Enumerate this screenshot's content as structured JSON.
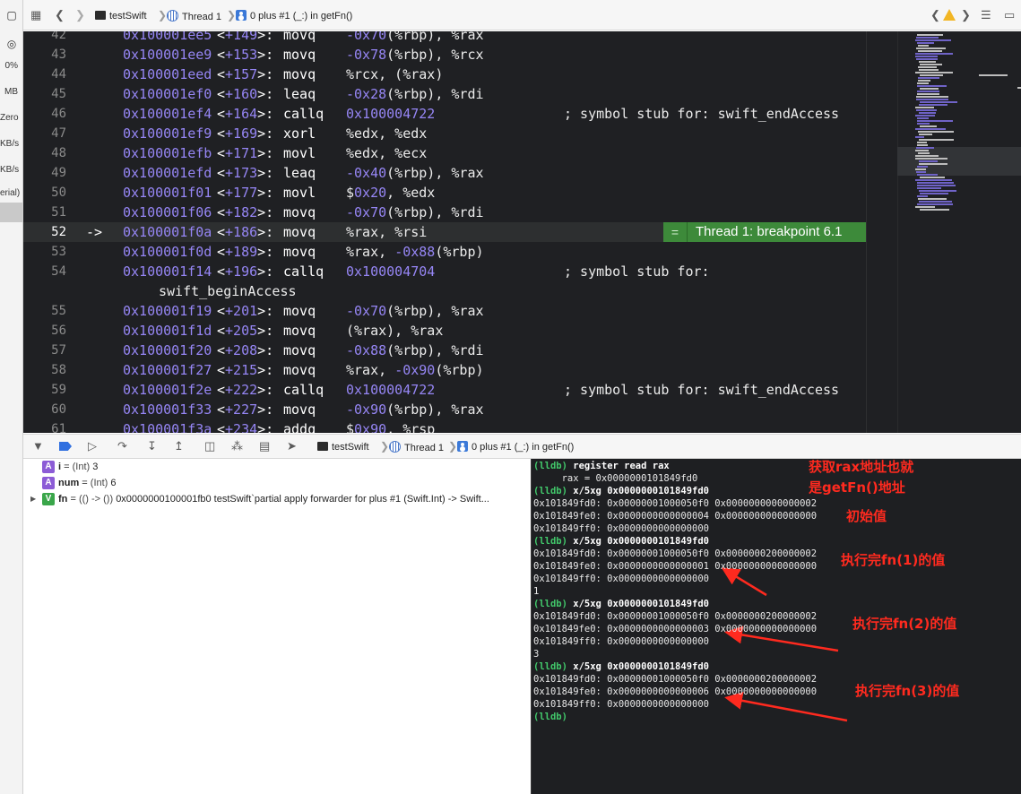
{
  "left_strip": {
    "items": [
      "0%",
      "MB",
      "Zero",
      "KB/s",
      "KB/s",
      "erial)"
    ]
  },
  "jumpbar": {
    "project": "testSwift",
    "thread": "Thread 1",
    "frame": "0 plus #1 (_:) in getFn()"
  },
  "editor": {
    "lines": [
      {
        "ln": "42",
        "addr": "0x100001ee5",
        "off": "+149",
        "mn": "movq",
        "ops": [
          [
            "n",
            "-0x70"
          ],
          [
            "t",
            "(%rbp), %rax"
          ]
        ],
        "cm": ""
      },
      {
        "ln": "43",
        "addr": "0x100001ee9",
        "off": "+153",
        "mn": "movq",
        "ops": [
          [
            "n",
            "-0x78"
          ],
          [
            "t",
            "(%rbp), %rcx"
          ]
        ],
        "cm": ""
      },
      {
        "ln": "44",
        "addr": "0x100001eed",
        "off": "+157",
        "mn": "movq",
        "ops": [
          [
            "t",
            "%rcx, (%rax)"
          ]
        ],
        "cm": ""
      },
      {
        "ln": "45",
        "addr": "0x100001ef0",
        "off": "+160",
        "mn": "leaq",
        "ops": [
          [
            "n",
            "-0x28"
          ],
          [
            "t",
            "(%rbp), %rdi"
          ]
        ],
        "cm": ""
      },
      {
        "ln": "46",
        "addr": "0x100001ef4",
        "off": "+164",
        "mn": "callq",
        "ops": [
          [
            "n",
            "0x100004722"
          ]
        ],
        "cm": "; symbol stub for: swift_endAccess"
      },
      {
        "ln": "47",
        "addr": "0x100001ef9",
        "off": "+169",
        "mn": "xorl",
        "ops": [
          [
            "t",
            "%edx, %edx"
          ]
        ],
        "cm": ""
      },
      {
        "ln": "48",
        "addr": "0x100001efb",
        "off": "+171",
        "mn": "movl",
        "ops": [
          [
            "t",
            "%edx, %ecx"
          ]
        ],
        "cm": ""
      },
      {
        "ln": "49",
        "addr": "0x100001efd",
        "off": "+173",
        "mn": "leaq",
        "ops": [
          [
            "n",
            "-0x40"
          ],
          [
            "t",
            "(%rbp), %rax"
          ]
        ],
        "cm": ""
      },
      {
        "ln": "50",
        "addr": "0x100001f01",
        "off": "+177",
        "mn": "movl",
        "ops": [
          [
            "t",
            "$"
          ],
          [
            "n",
            "0x20"
          ],
          [
            "t",
            ", %edx"
          ]
        ],
        "cm": ""
      },
      {
        "ln": "51",
        "addr": "0x100001f06",
        "off": "+182",
        "mn": "movq",
        "ops": [
          [
            "n",
            "-0x70"
          ],
          [
            "t",
            "(%rbp), %rdi"
          ]
        ],
        "cm": ""
      },
      {
        "ln": "52",
        "addr": "0x100001f0a",
        "off": "+186",
        "mn": "movq",
        "ops": [
          [
            "t",
            "%rax, %rsi"
          ]
        ],
        "cm": "",
        "current": true,
        "arrow": "->"
      },
      {
        "ln": "53",
        "addr": "0x100001f0d",
        "off": "+189",
        "mn": "movq",
        "ops": [
          [
            "t",
            "%rax, "
          ],
          [
            "n",
            "-0x88"
          ],
          [
            "t",
            "(%rbp)"
          ]
        ],
        "cm": ""
      },
      {
        "ln": "54",
        "addr": "0x100001f14",
        "off": "+196",
        "mn": "callq",
        "ops": [
          [
            "n",
            "0x100004704"
          ]
        ],
        "cm": "; symbol stub for:",
        "wrap": "swift_beginAccess"
      },
      {
        "ln": "55",
        "addr": "0x100001f19",
        "off": "+201",
        "mn": "movq",
        "ops": [
          [
            "n",
            "-0x70"
          ],
          [
            "t",
            "(%rbp), %rax"
          ]
        ],
        "cm": ""
      },
      {
        "ln": "56",
        "addr": "0x100001f1d",
        "off": "+205",
        "mn": "movq",
        "ops": [
          [
            "t",
            "(%rax), %rax"
          ]
        ],
        "cm": ""
      },
      {
        "ln": "57",
        "addr": "0x100001f20",
        "off": "+208",
        "mn": "movq",
        "ops": [
          [
            "n",
            "-0x88"
          ],
          [
            "t",
            "(%rbp), %rdi"
          ]
        ],
        "cm": ""
      },
      {
        "ln": "58",
        "addr": "0x100001f27",
        "off": "+215",
        "mn": "movq",
        "ops": [
          [
            "t",
            "%rax, "
          ],
          [
            "n",
            "-0x90"
          ],
          [
            "t",
            "(%rbp)"
          ]
        ],
        "cm": ""
      },
      {
        "ln": "59",
        "addr": "0x100001f2e",
        "off": "+222",
        "mn": "callq",
        "ops": [
          [
            "n",
            "0x100004722"
          ]
        ],
        "cm": "; symbol stub for: swift_endAccess"
      },
      {
        "ln": "60",
        "addr": "0x100001f33",
        "off": "+227",
        "mn": "movq",
        "ops": [
          [
            "n",
            "-0x90"
          ],
          [
            "t",
            "(%rbp), %rax"
          ]
        ],
        "cm": ""
      },
      {
        "ln": "61",
        "addr": "0x100001f3a",
        "off": "+234",
        "mn": "addq",
        "ops": [
          [
            "t",
            "$"
          ],
          [
            "n",
            "0x90"
          ],
          [
            "t",
            ", %rsp"
          ]
        ],
        "cm": ""
      }
    ],
    "breakpoint_label": "Thread 1: breakpoint 6.1",
    "breakpoint_eq": "="
  },
  "debugbar": {
    "project": "testSwift",
    "thread": "Thread 1",
    "frame": "0 plus #1 (_:) in getFn()"
  },
  "variables": [
    {
      "badge": "A",
      "badge_color": "#8c5cd6",
      "name": "i",
      "type": "(Int)",
      "value": "3",
      "expandable": false
    },
    {
      "badge": "A",
      "badge_color": "#8c5cd6",
      "name": "num",
      "type": "(Int)",
      "value": "6",
      "expandable": false
    },
    {
      "badge": "V",
      "badge_color": "#3aa64a",
      "name": "fn",
      "type": "(() -> ())",
      "value": "0x0000000100001fb0 testSwift`partial apply forwarder for plus #1 (Swift.Int) -> Swift...",
      "expandable": true
    }
  ],
  "console": {
    "lines": [
      {
        "kind": "cmd",
        "text": "(lldb) register read rax"
      },
      {
        "kind": "out",
        "text": "     rax = 0x0000000101849fd0"
      },
      {
        "kind": "cmd",
        "text": "(lldb) x/5xg 0x0000000101849fd0"
      },
      {
        "kind": "out",
        "text": "0x101849fd0: 0x00000001000050f0 0x0000000000000002"
      },
      {
        "kind": "out",
        "text": "0x101849fe0: 0x0000000000000004 0x0000000000000000"
      },
      {
        "kind": "out",
        "text": "0x101849ff0: 0x0000000000000000"
      },
      {
        "kind": "cmd",
        "text": "(lldb) x/5xg 0x0000000101849fd0"
      },
      {
        "kind": "out",
        "text": "0x101849fd0: 0x00000001000050f0 0x0000000200000002"
      },
      {
        "kind": "out",
        "text": "0x101849fe0: 0x0000000000000001 0x0000000000000000"
      },
      {
        "kind": "out",
        "text": "0x101849ff0: 0x0000000000000000"
      },
      {
        "kind": "out",
        "text": "1"
      },
      {
        "kind": "cmd",
        "text": "(lldb) x/5xg 0x0000000101849fd0"
      },
      {
        "kind": "out",
        "text": "0x101849fd0: 0x00000001000050f0 0x0000000200000002"
      },
      {
        "kind": "out",
        "text": "0x101849fe0: 0x0000000000000003 0x0000000000000000"
      },
      {
        "kind": "out",
        "text": "0x101849ff0: 0x0000000000000000"
      },
      {
        "kind": "out",
        "text": "3"
      },
      {
        "kind": "cmd",
        "text": "(lldb) x/5xg 0x0000000101849fd0"
      },
      {
        "kind": "out",
        "text": "0x101849fd0: 0x00000001000050f0 0x0000000200000002"
      },
      {
        "kind": "out",
        "text": "0x101849fe0: 0x0000000000000006 0x0000000000000000"
      },
      {
        "kind": "out",
        "text": "0x101849ff0: 0x0000000000000000"
      },
      {
        "kind": "prompt",
        "text": "(lldb)"
      }
    ],
    "annotations": {
      "note1_line1": "获取rax地址也就",
      "note1_line2": "是getFn()地址",
      "note2": "初始值",
      "note3": "执行完fn(1)的值",
      "note4": "执行完fn(2)的值",
      "note5": "执行完fn(3)的值"
    },
    "annotation_color": "#ff2a1f"
  },
  "colors": {
    "editor_bg": "#1f2023",
    "number": "#9686f5",
    "breakpoint_green": "#3d8a3a",
    "console_prompt_green": "#42c96b",
    "accent_blue": "#2f6fe0"
  }
}
